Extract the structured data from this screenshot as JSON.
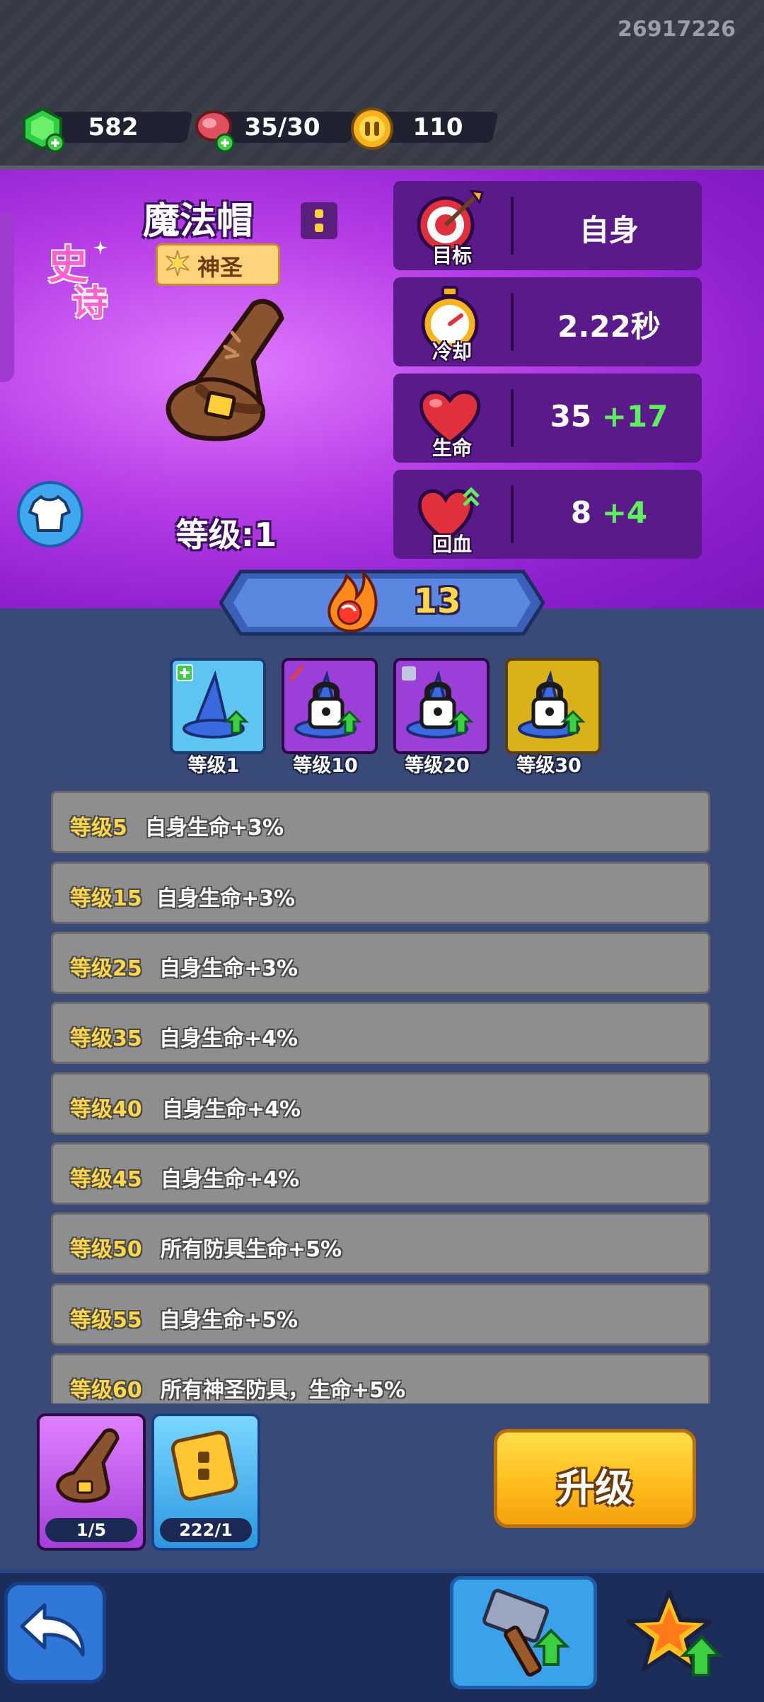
{
  "player_id": "26917226",
  "resources": [
    {
      "name": "gems",
      "icon": "green-gem-icon",
      "value": "582"
    },
    {
      "name": "meat",
      "icon": "meat-icon",
      "value": "35/30"
    },
    {
      "name": "coins",
      "icon": "gold-coin-icon",
      "value": "110"
    }
  ],
  "item": {
    "name": "魔法帽",
    "tag": "神圣",
    "rarity_line1": "史",
    "rarity_line2": "诗",
    "level_label": "等级:1"
  },
  "stats": [
    {
      "label": "目标",
      "icon": "target-icon",
      "value": "自身",
      "bonus": ""
    },
    {
      "label": "冷却",
      "icon": "stopwatch-icon",
      "value": "2.22秒",
      "bonus": ""
    },
    {
      "label": "生命",
      "icon": "heart-icon",
      "value": "35 ",
      "bonus": "+17"
    },
    {
      "label": "回血",
      "icon": "heart-regen-icon",
      "value": "8 ",
      "bonus": "+4"
    }
  ],
  "power": "13",
  "skills": [
    {
      "label": "等级1",
      "locked": false,
      "tier": "blue"
    },
    {
      "label": "等级10",
      "locked": true,
      "tier": "purple"
    },
    {
      "label": "等级20",
      "locked": true,
      "tier": "purple"
    },
    {
      "label": "等级30",
      "locked": true,
      "tier": "gold"
    }
  ],
  "bonuses": [
    {
      "level": "等级5",
      "text": "自身生命+3%"
    },
    {
      "level": "等级15",
      "text": "自身生命+3%"
    },
    {
      "level": "等级25",
      "text": "自身生命+3%"
    },
    {
      "level": "等级35",
      "text": "自身生命+4%"
    },
    {
      "level": "等级40",
      "text": "自身生命+4%"
    },
    {
      "level": "等级45",
      "text": "自身生命+4%"
    },
    {
      "level": "等级50",
      "text": "所有防具生命+5%"
    },
    {
      "level": "等级55",
      "text": "自身生命+5%"
    },
    {
      "level": "等级60",
      "text": "所有神圣防具，生命+5%"
    }
  ],
  "materials": [
    {
      "name": "wizard-hat",
      "count": "1/5"
    },
    {
      "name": "upgrade-scroll",
      "count": "222/1"
    }
  ],
  "upgrade_label": "升级",
  "colors": {
    "accent": "#b63ee6",
    "upgrade": "#ffbe1c",
    "bonus_green": "#5cf05a",
    "level_gold": "#ffd84a"
  }
}
